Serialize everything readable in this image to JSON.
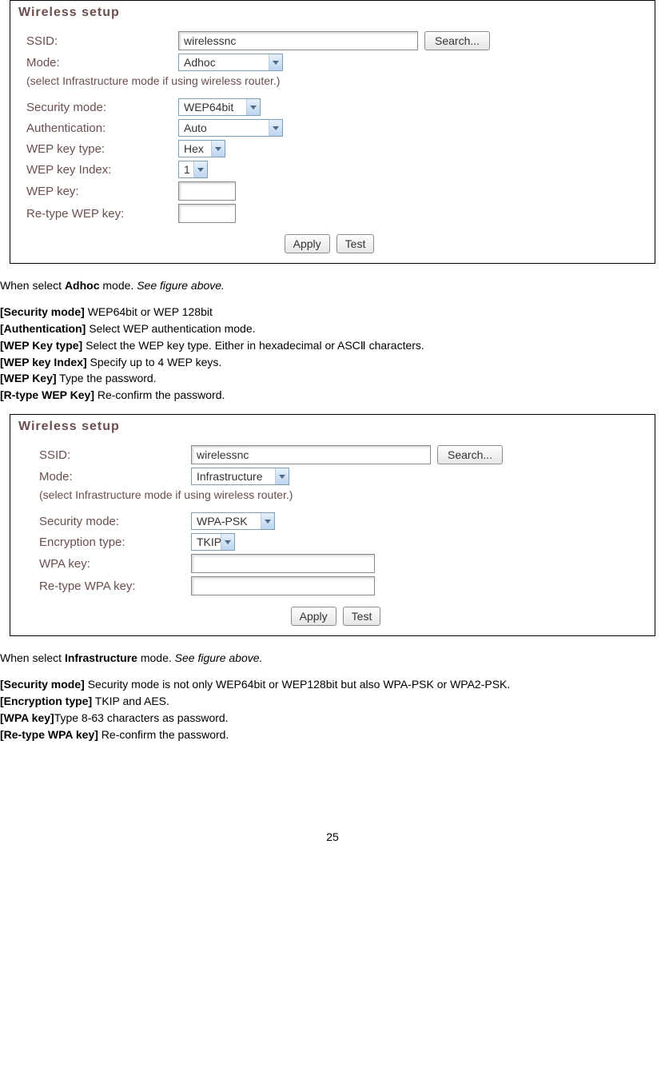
{
  "figure1": {
    "title": "Wireless setup",
    "ssid_label": "SSID:",
    "ssid_value": "wirelessnc",
    "search_label": "Search...",
    "mode_label": "Mode:",
    "mode_value": "Adhoc",
    "mode_hint": "(select Infrastructure mode if using wireless router.)",
    "security_label": "Security mode:",
    "security_value": "WEP64bit",
    "auth_label": "Authentication:",
    "auth_value": "Auto",
    "keytype_label": "WEP key type:",
    "keytype_value": "Hex",
    "keyindex_label": "WEP key Index:",
    "keyindex_value": "1",
    "wepkey_label": "WEP key:",
    "retype_label": "Re-type WEP key:",
    "apply_label": "Apply",
    "test_label": "Test"
  },
  "text1": {
    "intro_a": "When select ",
    "intro_b": "Adhoc",
    "intro_c": " mode. ",
    "intro_d": "See figure above.",
    "l1a": "[Security mode]",
    "l1b": " WEP64bit or WEP 128bit",
    "l2a": "[Authentication]",
    "l2b": " Select WEP authentication mode.",
    "l3a": "[WEP Key type]",
    "l3b": " Select the WEP key type. Either in hexadecimal or ASCⅡ characters.",
    "l4a": "[WEP key Index]",
    "l4b": " Specify up to 4 WEP keys.",
    "l5a": "[WEP Key]",
    "l5b": " Type the password.",
    "l6a": "[R-type WEP Key]",
    "l6b": " Re-confirm the password."
  },
  "figure2": {
    "title": "Wireless setup",
    "ssid_label": "SSID:",
    "ssid_value": "wirelessnc",
    "search_label": "Search...",
    "mode_label": "Mode:",
    "mode_value": "Infrastructure",
    "mode_hint": "(select Infrastructure mode if using wireless router.)",
    "security_label": "Security mode:",
    "security_value": "WPA-PSK",
    "enc_label": "Encryption type:",
    "enc_value": "TKIP",
    "wpakey_label": "WPA key:",
    "retype_label": "Re-type WPA key:",
    "apply_label": "Apply",
    "test_label": "Test"
  },
  "text2": {
    "intro_a": "When select ",
    "intro_b": "Infrastructure",
    "intro_c": " mode. ",
    "intro_d": "See figure above.",
    "l1a": "[Security mode]",
    "l1b": " Security mode is not only WEP64bit or WEP128bit but also WPA-PSK or WPA2-PSK.",
    "l2a": "[Encryption type]",
    "l2b": " TKIP and AES.",
    "l3a": "[WPA key]",
    "l3b": "Type 8-63 characters as password.",
    "l4a": "[Re-type WPA key]",
    "l4b": " Re-confirm the password."
  },
  "page_number": "25"
}
